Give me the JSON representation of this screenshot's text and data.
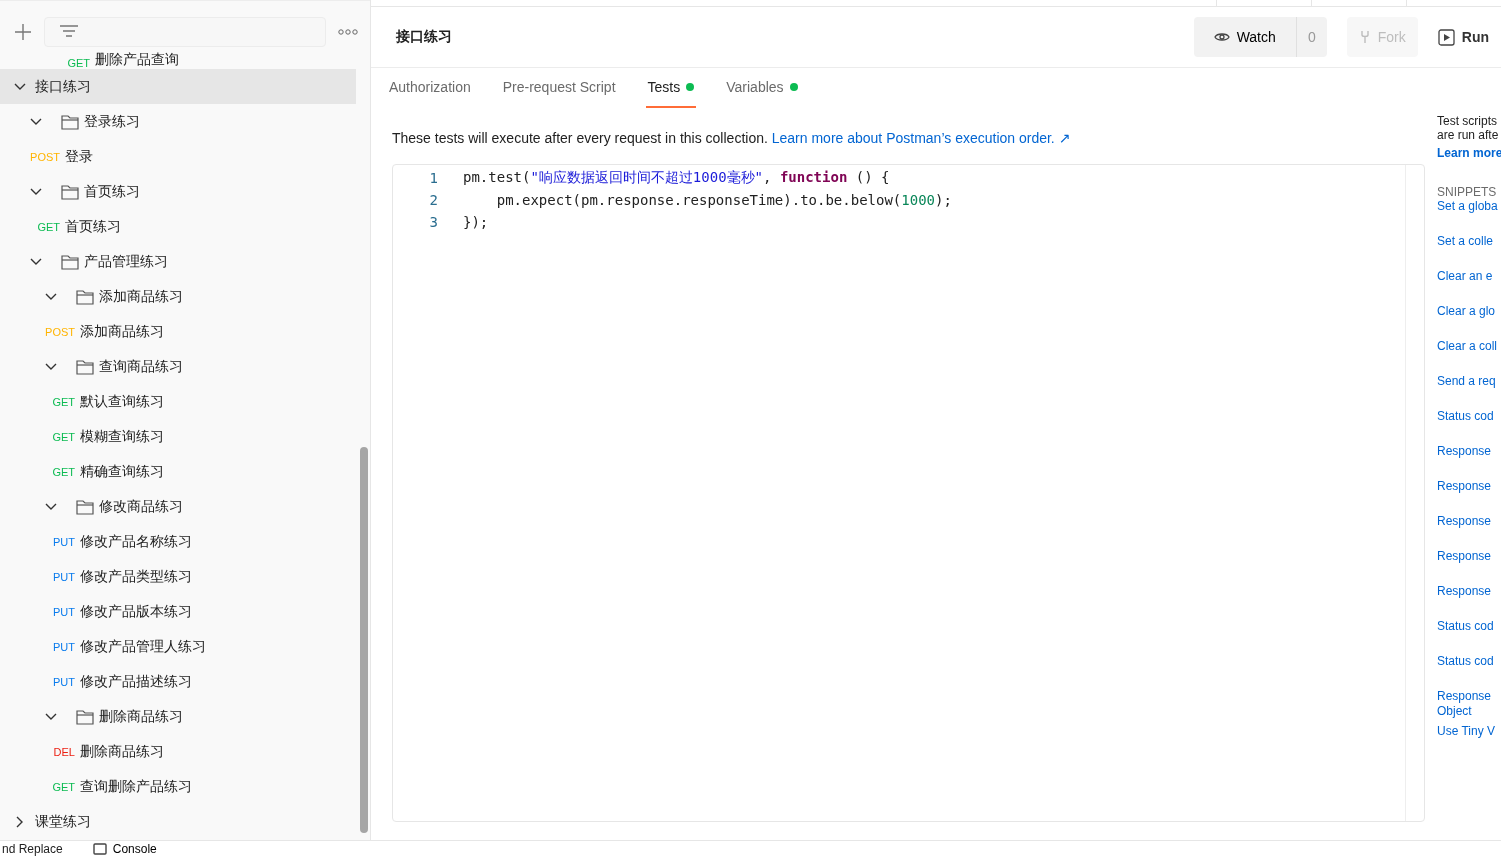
{
  "sidebar": {
    "partial_row": {
      "method": "GET",
      "name": "删除产品查询",
      "color": "#0cbb52"
    },
    "tree": [
      {
        "kind": "collection",
        "name": "接口练习",
        "expanded": true,
        "selected": true,
        "children": [
          {
            "kind": "folder",
            "name": "登录练习",
            "expanded": true,
            "selected": false,
            "children": [
              {
                "kind": "request",
                "method": "POST",
                "color": "#ffb400",
                "name": "登录",
                "selected": false
              }
            ]
          },
          {
            "kind": "folder",
            "name": "首页练习",
            "expanded": true,
            "selected": false,
            "children": [
              {
                "kind": "request",
                "method": "GET",
                "color": "#0cbb52",
                "name": "首页练习",
                "selected": false
              }
            ]
          },
          {
            "kind": "folder",
            "name": "产品管理练习",
            "expanded": true,
            "selected": false,
            "children": [
              {
                "kind": "folder",
                "name": "添加商品练习",
                "expanded": true,
                "selected": false,
                "children": [
                  {
                    "kind": "request",
                    "method": "POST",
                    "color": "#ffb400",
                    "name": "添加商品练习",
                    "selected": false
                  }
                ]
              },
              {
                "kind": "folder",
                "name": "查询商品练习",
                "expanded": true,
                "selected": false,
                "children": [
                  {
                    "kind": "request",
                    "method": "GET",
                    "color": "#0cbb52",
                    "name": "默认查询练习",
                    "selected": false
                  },
                  {
                    "kind": "request",
                    "method": "GET",
                    "color": "#0cbb52",
                    "name": "模糊查询练习",
                    "selected": false
                  },
                  {
                    "kind": "request",
                    "method": "GET",
                    "color": "#0cbb52",
                    "name": "精确查询练习",
                    "selected": false
                  }
                ]
              },
              {
                "kind": "folder",
                "name": "修改商品练习",
                "expanded": true,
                "selected": false,
                "children": [
                  {
                    "kind": "request",
                    "method": "PUT",
                    "color": "#097bed",
                    "name": "修改产品名称练习",
                    "selected": false
                  },
                  {
                    "kind": "request",
                    "method": "PUT",
                    "color": "#097bed",
                    "name": "修改产品类型练习",
                    "selected": false
                  },
                  {
                    "kind": "request",
                    "method": "PUT",
                    "color": "#097bed",
                    "name": "修改产品版本练习",
                    "selected": false
                  },
                  {
                    "kind": "request",
                    "method": "PUT",
                    "color": "#097bed",
                    "name": "修改产品管理人练习",
                    "selected": false
                  },
                  {
                    "kind": "request",
                    "method": "PUT",
                    "color": "#097bed",
                    "name": "修改产品描述练习",
                    "selected": false
                  }
                ]
              },
              {
                "kind": "folder",
                "name": "删除商品练习",
                "expanded": true,
                "selected": false,
                "children": [
                  {
                    "kind": "request",
                    "method": "DEL",
                    "color": "#eb2013",
                    "name": "删除商品练习",
                    "selected": false
                  },
                  {
                    "kind": "request",
                    "method": "GET",
                    "color": "#0cbb52",
                    "name": "查询删除产品练习",
                    "selected": false
                  }
                ]
              }
            ]
          }
        ]
      },
      {
        "kind": "collection",
        "name": "课堂练习",
        "expanded": false,
        "selected": false
      }
    ]
  },
  "header": {
    "title": "接口练习",
    "watch": {
      "label": "Watch",
      "count": "0"
    },
    "fork": {
      "label": "Fork",
      "disabled": true
    },
    "run": {
      "label": "Run"
    }
  },
  "tabs": [
    {
      "label": "Authorization",
      "selected": false,
      "dot": false
    },
    {
      "label": "Pre-request Script",
      "selected": false,
      "dot": false
    },
    {
      "label": "Tests",
      "selected": true,
      "dot": true
    },
    {
      "label": "Variables",
      "selected": false,
      "dot": true
    }
  ],
  "info": {
    "text": "These tests will execute after every request in this collection.",
    "link": "Learn more about Postman’s execution order. ↗"
  },
  "code": [
    {
      "number": "1",
      "tokens": [
        {
          "kind": "plain",
          "text": "pm.test("
        },
        {
          "kind": "string",
          "text": "\"响应数据返回时间不超过1000毫秒\""
        },
        {
          "kind": "plain",
          "text": ", "
        },
        {
          "kind": "keyword",
          "text": "function"
        },
        {
          "kind": "plain",
          "text": " () {"
        }
      ]
    },
    {
      "number": "2",
      "tokens": [
        {
          "kind": "plain",
          "text": "    pm.expect(pm.response.responseTime).to.be.below("
        },
        {
          "kind": "number",
          "text": "1000"
        },
        {
          "kind": "plain",
          "text": ");"
        }
      ]
    },
    {
      "number": "3",
      "tokens": [
        {
          "kind": "plain",
          "text": "});"
        }
      ]
    }
  ],
  "side_panel": {
    "description": [
      "Test scripts",
      "are run afte"
    ],
    "learn_more": "Learn more",
    "snippets_title": "SNIPPETS",
    "snippets": [
      "Set a globa",
      "Set a colle",
      "Clear an e",
      "Clear a glo",
      "Clear a coll",
      "Send a req",
      "Status cod",
      "Response",
      "Response",
      "Response",
      "Response",
      "Response",
      "Status cod",
      "Status cod",
      "Response Object",
      "Use Tiny V"
    ]
  },
  "status_bar": {
    "items": [
      {
        "kind": "text",
        "label": "nd Replace"
      },
      {
        "kind": "console",
        "label": "Console"
      }
    ]
  }
}
